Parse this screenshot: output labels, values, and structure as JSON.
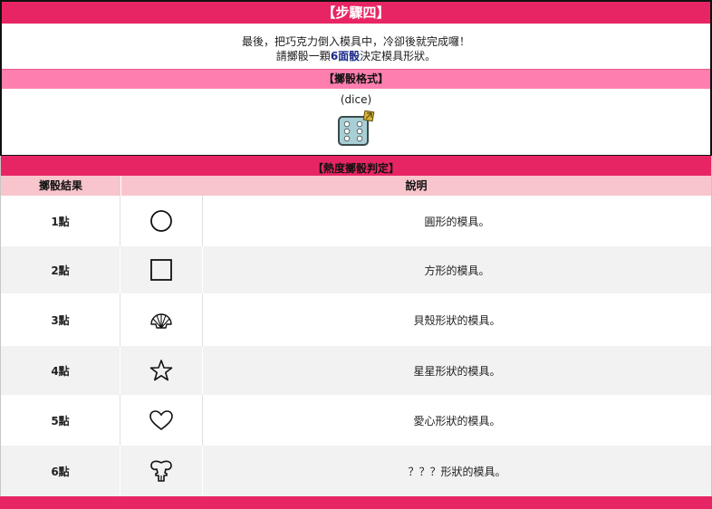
{
  "step": {
    "title": "【步驟四】",
    "line1": "最後，把巧克力倒入模具中，冷卻後就完成囉！",
    "line2_pre": "請擲骰一顆",
    "line2_highlight": "6面骰",
    "line2_post": "決定模具形狀。"
  },
  "dice_format": {
    "title": "【擲骰格式】",
    "code": "(dice)"
  },
  "judgement": {
    "title": "【熱度擲骰判定】",
    "col_result": "擲骰結果",
    "col_desc": "說明",
    "rows": [
      {
        "result": "1點",
        "icon": "circle-icon",
        "desc": "圓形的模具。"
      },
      {
        "result": "2點",
        "icon": "square-icon",
        "desc": "方形的模具。"
      },
      {
        "result": "3點",
        "icon": "shell-icon",
        "desc": "貝殼形狀的模具。"
      },
      {
        "result": "4點",
        "icon": "star-icon",
        "desc": "星星形狀的模具。"
      },
      {
        "result": "5點",
        "icon": "heart-icon",
        "desc": "愛心形狀的模具。"
      },
      {
        "result": "6點",
        "icon": "mystery-shape-icon",
        "desc": "？？？形狀的模具。"
      }
    ]
  },
  "colors": {
    "header_pink": "#e82564",
    "subheader_pink": "#fe7faf",
    "column_header": "#f8c5cc",
    "highlight_blue": "#1a2a8a",
    "dice_face": "#a9cfd6"
  }
}
